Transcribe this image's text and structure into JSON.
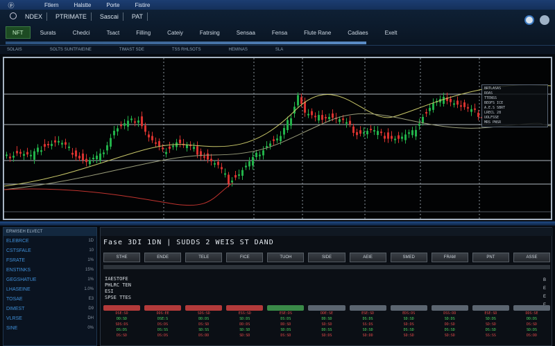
{
  "title_bar": {
    "logo": "ⓟ",
    "menu": [
      "Ftlern",
      "Halstte",
      "Porte",
      "Fistire"
    ]
  },
  "toolbar": {
    "row1": [
      "NDEX",
      "PTRIMATE",
      "Sascai",
      "PAT"
    ],
    "buttons": [
      "NFT",
      "Surats",
      "Chedci",
      "Tsact",
      "Filling",
      "Cateiy",
      "Fatrsing",
      "Sensaa",
      "Fensa",
      "Flute Rane",
      "Cadiaes",
      "Exelt"
    ],
    "active_index": 0,
    "progress": 1.0
  },
  "subbar": [
    "SOLAIS",
    "SOLTS SUNTFAIEINE",
    "TIMAST SDE",
    "TSS RHLSOTS",
    "HEMINAS",
    "SLA"
  ],
  "chart_legend": [
    "BRTLASAS",
    "ROAS",
    "TTENSS",
    "BEOFS ICE",
    "A.E.S SBRT",
    "LRECL 28",
    "UOLFSSE",
    "MRS PNSR"
  ],
  "left_panel": {
    "header": "ERWISEH ELVECT",
    "rows": [
      {
        "k": "ELEBRCE",
        "v": "1D"
      },
      {
        "k": "CSTSFALE",
        "v": "10"
      },
      {
        "k": "FSRATE",
        "v": "1%"
      },
      {
        "k": "ENSTINKS",
        "v": "15%"
      },
      {
        "k": "GEGSHATUE",
        "v": "1%"
      },
      {
        "k": "LHASEINE",
        "v": "1.0%"
      },
      {
        "k": "TOSAE",
        "v": "E3"
      },
      {
        "k": "DIMEST",
        "v": "D9"
      },
      {
        "k": "VLRSE",
        "v": "DH"
      },
      {
        "k": "SINE",
        "v": "0%"
      }
    ]
  },
  "main_panel": {
    "title": "Fase  3DI  1DN  |  SUDDS 2 WEIS ST DAND",
    "tabs": [
      "STHE",
      "ENDE",
      "TELE",
      "FICE",
      "TUOH",
      "SIDE",
      "AEIE",
      "SMED",
      "FRAM",
      "PNT",
      "ASSE"
    ],
    "info": [
      "IAESTOFE",
      "PHLRC TEN",
      "ESI",
      "SPSE  TTES"
    ],
    "side": [
      "B",
      "E",
      "E",
      "E"
    ],
    "columns": [
      {
        "color": "red",
        "cells": [
          "DSE:SD",
          "DD:SD",
          "SDS:DS",
          "DS:DS",
          "DS:SD"
        ]
      },
      {
        "color": "red",
        "cells": [
          "DDS:EE",
          "DSE:S",
          "DS:DS",
          "DS:SS",
          "DS:DS"
        ]
      },
      {
        "color": "red",
        "cells": [
          "SDS:SD",
          "DD:DS",
          "DS:SD",
          "SD:SS",
          "DS:DD"
        ]
      },
      {
        "color": "red",
        "cells": [
          "ESS:SD",
          "SD:DS",
          "DD:DS",
          "SD:SD",
          "SD:SD"
        ]
      },
      {
        "color": "green",
        "cells": [
          "ESE:DS",
          "DS:DS",
          "DD:SD",
          "SD:DS",
          "DS:SD"
        ]
      },
      {
        "color": "grey",
        "cells": [
          "DDE:SE",
          "DD:SD",
          "SD:SD",
          "DD:SS",
          "SD:DS"
        ]
      },
      {
        "color": "grey",
        "cells": [
          "ESE:SD",
          "DS:DS",
          "SS:DS",
          "SD:SD",
          "SD:DD"
        ]
      },
      {
        "color": "grey",
        "cells": [
          "EDS:DS",
          "SD:SD",
          "SD:DS",
          "DS:SD",
          "SD:SD"
        ]
      },
      {
        "color": "grey",
        "cells": [
          "DSS:DD",
          "SD:DS",
          "DD:SD",
          "DS:SD",
          "SD:SD"
        ]
      },
      {
        "color": "grey",
        "cells": [
          "ESE:SD",
          "SD:DS",
          "SD:SD",
          "DS:SD",
          "SS:SS"
        ]
      },
      {
        "color": "grey",
        "cells": [
          "DDS:SE",
          "DD:DS",
          "DS:SD",
          "SD:DS",
          "DS:DD"
        ]
      }
    ]
  },
  "colors": {
    "up": "#22b24a",
    "down": "#d9322f",
    "grid": "#b0b8c0",
    "ma1": "#c9c86a",
    "ma2": "#9a9d7b",
    "ma3": "#c3342f"
  }
}
